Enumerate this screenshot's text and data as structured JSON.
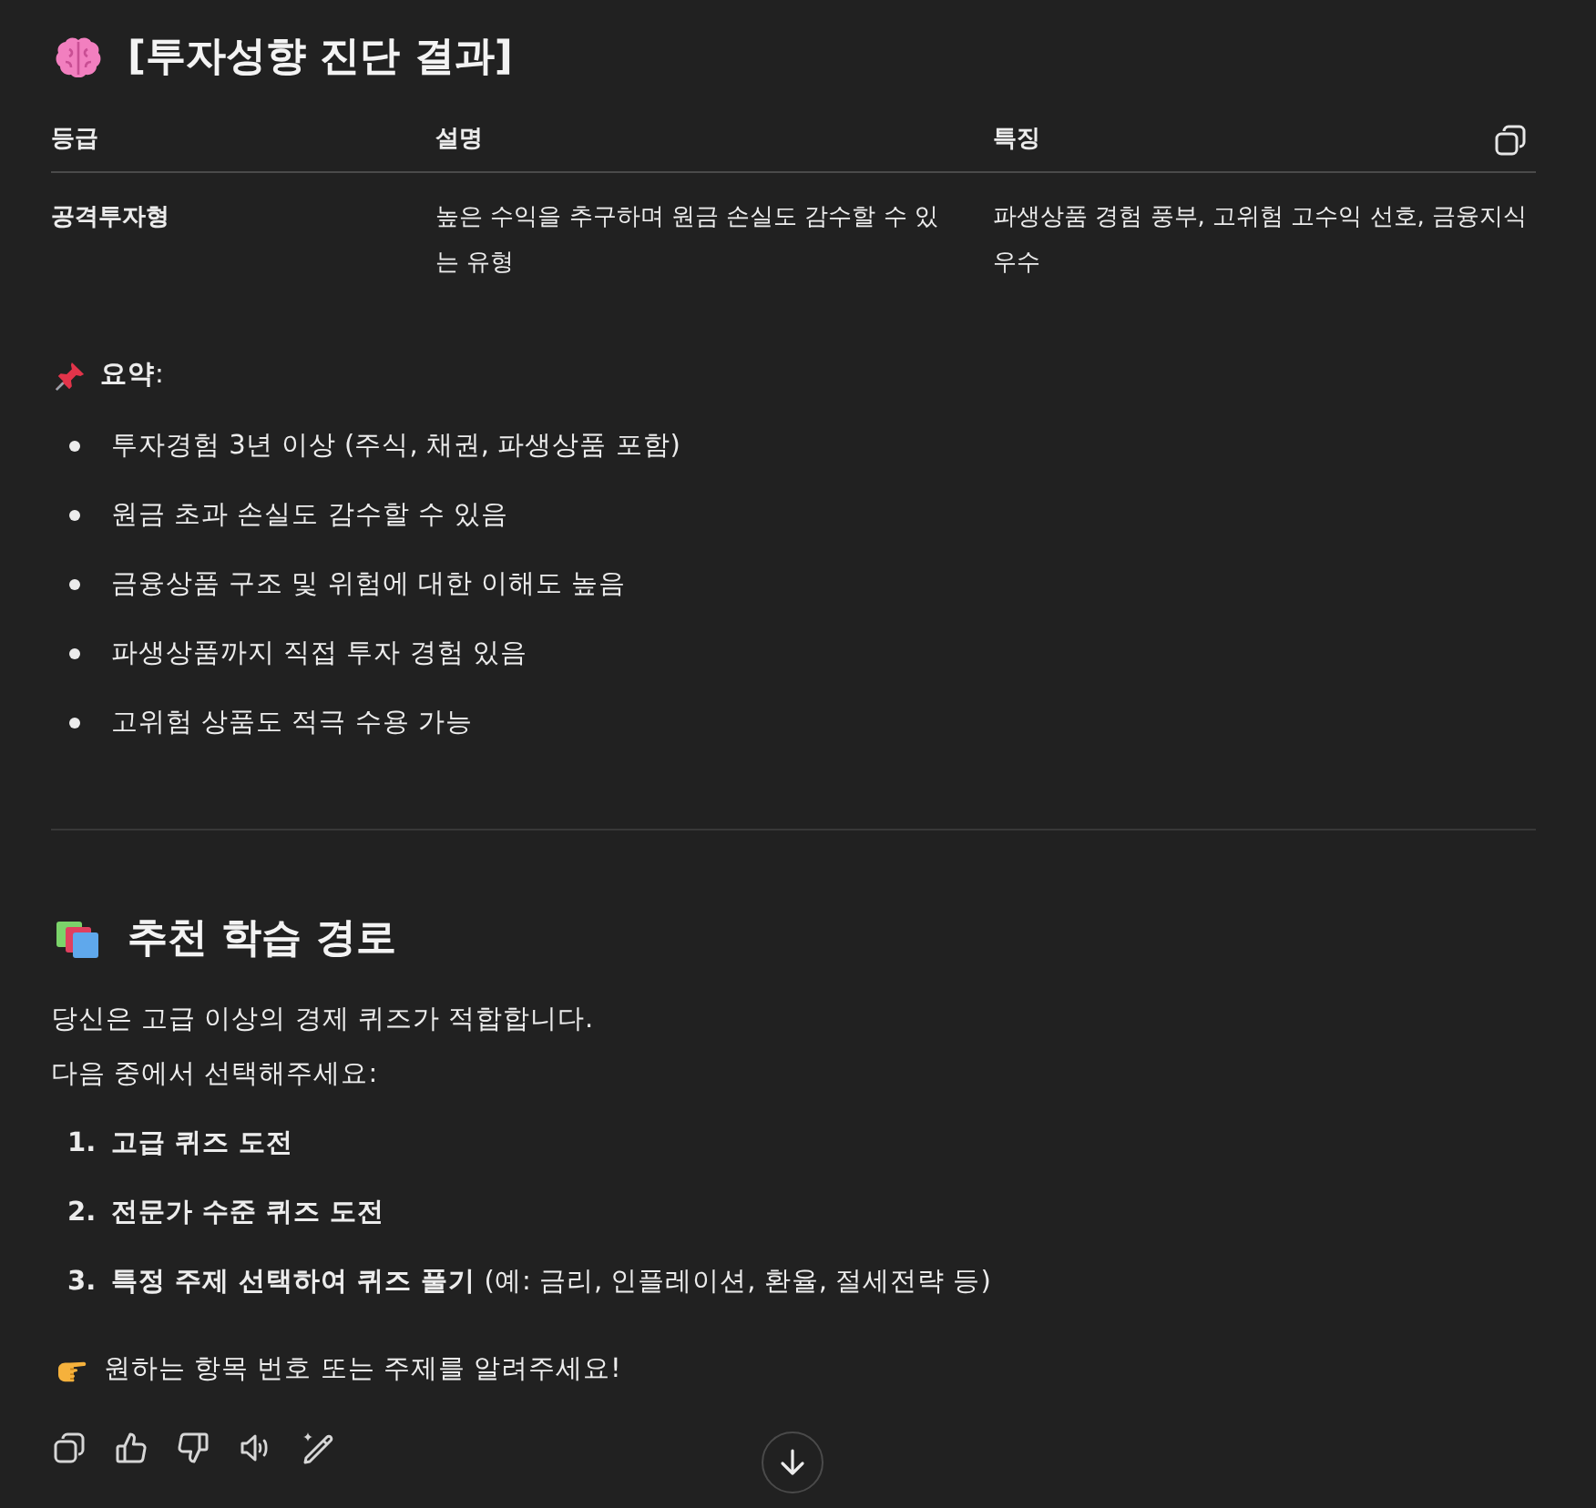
{
  "result": {
    "title": "[투자성향 진단 결과]",
    "table": {
      "columns": [
        "등급",
        "설명",
        "특징"
      ],
      "rows": [
        [
          "공격투자형",
          "높은 수익을 추구하며 원금 손실도 감수할 수 있는 유형",
          "파생상품 경험 풍부, 고위험 고수익 선호, 금융지식 우수"
        ]
      ]
    },
    "summary": {
      "label": "**요약**:",
      "items": [
        "투자경험 3년 이상 (주식, 채권, 파생상품 포함)",
        "원금 초과 손실도 감수할 수 있음",
        "금융상품 구조 및 위험에 대한 이해도 높음",
        "파생상품까지 직접 투자 경험 있음",
        "고위험 상품도 적극 수용 가능"
      ]
    }
  },
  "learning_path": {
    "title": "추천 학습 경로",
    "intro_lines": [
      "당신은 고급 이상의 경제 퀴즈가 적합합니다.",
      "다음 중에서 선택해주세요:"
    ],
    "options": [
      {
        "number": "1.",
        "label": "고급 퀴즈 도전"
      },
      {
        "number": "2.",
        "label": "전문가 수준 퀴즈 도전"
      },
      {
        "number": "3.",
        "label": "특정 주제 선택하여 퀴즈 풀기",
        "detail": "(예: 금리, 인플레이션, 환율, 절세전략 등)"
      }
    ],
    "closing": "원하는 항목 번호 또는 주제를 알려주세요!"
  }
}
